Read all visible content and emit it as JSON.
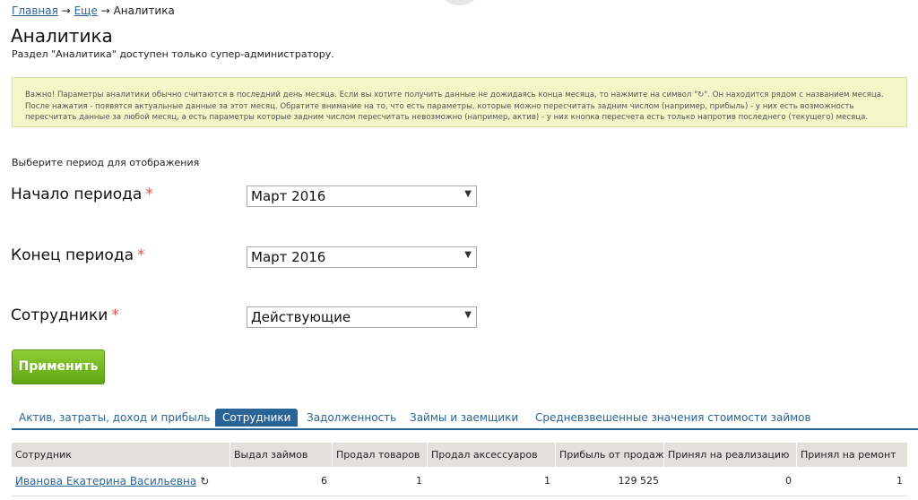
{
  "breadcrumb": {
    "home": "Главная",
    "more": "Еще",
    "sep1": "→",
    "sep2": "→",
    "current": "Аналитика"
  },
  "page": {
    "title": "Аналитика",
    "subtitle": "Раздел \"Аналитика\" доступен только супер-администратору."
  },
  "notice": {
    "text": "Важно! Параметры аналитики обычно считаются в последний день месяца. Если вы хотите получить данные не дожидаясь конца месяца, то нажмите на символ \"↻\". Он находится рядом с названием месяца. После нажатия - появятся актуальные данные за этот месяц. Обратите внимание на то, что есть параметры, которые можно пересчитать задним числом (например, прибыль) - у них есть возможность пересчитать данные за любой месяц, а есть параметры которые задним числом пересчитать невозможно (например, актив) - у них кнопка пересчета есть только напротив последнего (текущего) месяца."
  },
  "form": {
    "hint": "Выберите период для отображения",
    "required_mark": "*",
    "start": {
      "label": "Начало периода",
      "value": "Март 2016"
    },
    "end": {
      "label": "Конец периода",
      "value": "Март 2016"
    },
    "staff": {
      "label": "Сотрудники",
      "value": "Действующие"
    },
    "arrow": "▼",
    "apply": "Применить"
  },
  "tabs": [
    {
      "label": "Актив, затраты, доход и прибыль",
      "active": false
    },
    {
      "label": "Сотрудники",
      "active": true
    },
    {
      "label": "Задолженность",
      "active": false
    },
    {
      "label": "Займы и заемщики",
      "active": false
    },
    {
      "label": "Средневзвешенные значения стоимости займов",
      "active": false
    }
  ],
  "table": {
    "columns": [
      "Сотрудник",
      "Выдал займов",
      "Продал товаров",
      "Продал аксессуаров",
      "Прибыль от продаж",
      "Принял на реализацию",
      "Принял на ремонт"
    ],
    "rows": [
      {
        "employee": "Иванова Екатерина Васильевна",
        "reload": "↻",
        "loans": "6",
        "goods": "1",
        "accessories": "1",
        "profit": "129 525",
        "consignment": "0",
        "repair": "1"
      }
    ]
  },
  "colors": {
    "link": "#2a6496",
    "notice_bg": "#f2f7c8",
    "apply_btn": "#6cb31e",
    "required": "#d9534f"
  }
}
